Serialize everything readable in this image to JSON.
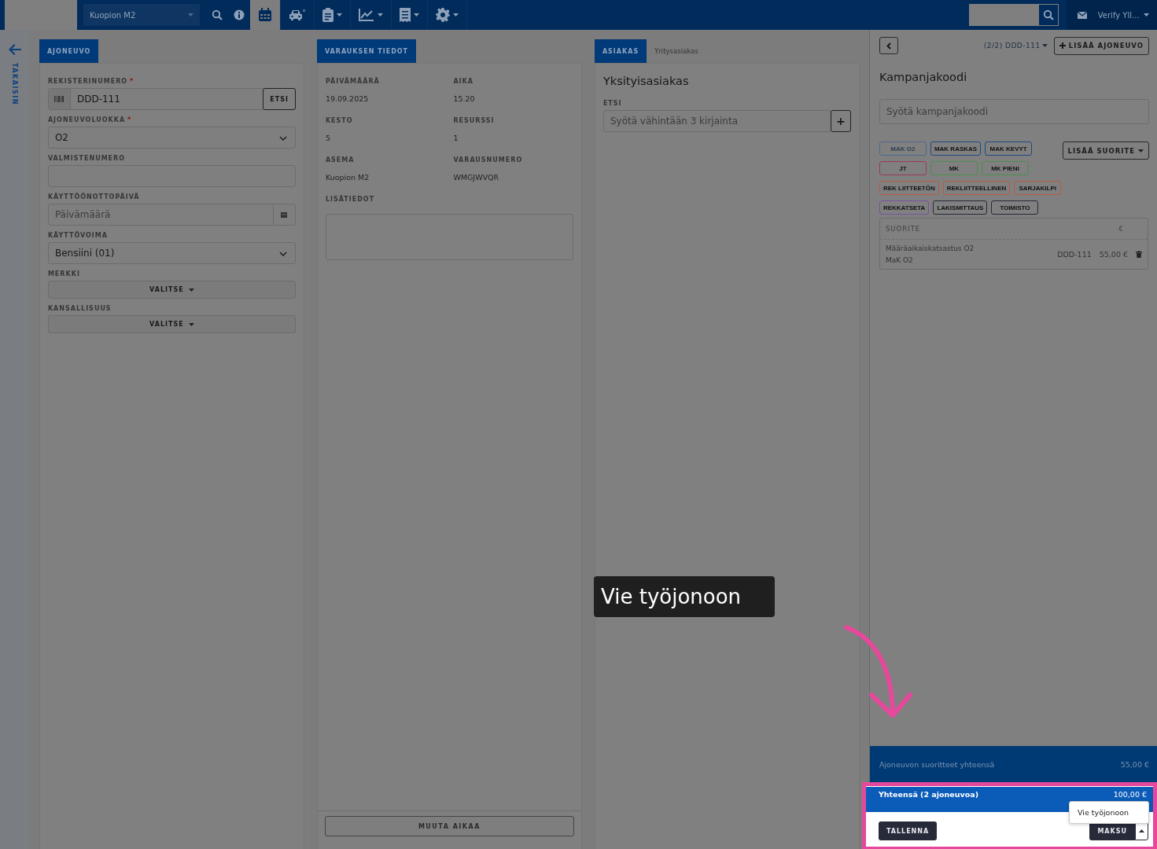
{
  "topbar": {
    "station_select": {
      "value": "Kuopion M2"
    },
    "nav_items": [
      {
        "kind": "search",
        "selected": false,
        "has_menu": false
      },
      {
        "kind": "info",
        "selected": false,
        "has_menu": false
      },
      {
        "kind": "calendar",
        "selected": true,
        "has_menu": false
      },
      {
        "kind": "car",
        "selected": false,
        "has_menu": false
      },
      {
        "kind": "clipboard",
        "selected": false,
        "has_menu": true
      },
      {
        "kind": "chart",
        "selected": false,
        "has_menu": true
      },
      {
        "kind": "receipt",
        "selected": false,
        "has_menu": true
      },
      {
        "kind": "gear",
        "selected": false,
        "has_menu": true
      }
    ],
    "user": {
      "name": "Verify Yll…"
    }
  },
  "sidebar": {
    "back_label": "TAKAISIN"
  },
  "vehicle_panel": {
    "tab": "AJONEUVO",
    "fields": [
      {
        "kind": "lookup",
        "label": "REKISTERINUMERO",
        "required_mark": "*",
        "value": "DDD-111",
        "button": "ETSI"
      },
      {
        "kind": "select",
        "label": "AJONEUVOLUOKKA",
        "required_mark": "*",
        "value": "O2"
      },
      {
        "kind": "text",
        "label": "VALMISTENUMERO"
      },
      {
        "kind": "date",
        "label": "KÄYTTÖÖNOTTOPÄIVÄ",
        "placeholder": "Päivämäärä"
      },
      {
        "kind": "select",
        "label": "KÄYTTÖVOIMA",
        "value": "Bensiini (01)"
      },
      {
        "kind": "dropdown",
        "label": "MERKKI",
        "button": "VALITSE"
      },
      {
        "kind": "dropdown",
        "label": "KANSALLISUUS",
        "button": "VALITSE"
      }
    ]
  },
  "booking_panel": {
    "tab": "VARAUKSEN TIEDOT",
    "details": [
      {
        "label": "PÄIVÄMÄÄRÄ",
        "value": "19.09.2025"
      },
      {
        "label": "AIKA",
        "value": "15.20"
      },
      {
        "label": "KESTO",
        "value": "5"
      },
      {
        "label": "RESURSSI",
        "value": "1"
      },
      {
        "label": "ASEMA",
        "value": "Kuopion M2"
      },
      {
        "label": "VARAUSNUMERO",
        "value": "WMGJWVQR"
      }
    ],
    "notes_label": "LISÄTIEDOT",
    "change_time_button": "MUUTA AIKAA"
  },
  "customer_panel": {
    "tabs": [
      {
        "label": "ASIAKAS",
        "selected": true
      },
      {
        "label": "Yritysasiakas",
        "selected": false
      }
    ],
    "heading": "Yksityisasiakas",
    "search_label": "ETSI",
    "search_placeholder": "Syötä vähintään 3 kirjainta",
    "add_button": "+"
  },
  "right_panel": {
    "vehicle_switch": "(2/2) DDD-111",
    "add_vehicle_button": "LISÄÄ AJONEUVO",
    "campaign_heading": "Kampanjakoodi",
    "campaign_placeholder": "Syötä kampanjakoodi",
    "chip_rows": [
      [
        {
          "label": "MAK O2",
          "color": "#4d6a8c",
          "disabled": true
        },
        {
          "label": "MAK RASKAS",
          "color": "#1c4a85",
          "disabled": false
        },
        {
          "label": "MAK KEVYT",
          "color": "#1c4a85",
          "disabled": false
        }
      ],
      [
        {
          "label": "JT",
          "color": "#98385a",
          "disabled": false
        },
        {
          "label": "MK",
          "color": "#4b8f4b",
          "disabled": false
        },
        {
          "label": "MK PIENI",
          "color": "#4b8f4b",
          "disabled": false
        }
      ],
      [
        {
          "label": "REK LIITTEETÖN",
          "color": "#b85a40",
          "disabled": false
        },
        {
          "label": "REKLIITTEELLINEN",
          "color": "#b85a40",
          "disabled": false
        },
        {
          "label": "SARJAKILPI",
          "color": "#b85a40",
          "disabled": false
        }
      ],
      [
        {
          "label": "REKKATSETA",
          "color": "#7b4f9c",
          "disabled": false
        },
        {
          "label": "LAKISMITTAUS",
          "color": "#262a36",
          "disabled": false
        },
        {
          "label": "TOIMISTO",
          "color": "#262a36",
          "disabled": false
        }
      ]
    ],
    "add_service_button": "LISÄÄ SUORITE",
    "table": {
      "columns": [
        "SUORITE",
        "€"
      ],
      "rows": [
        {
          "name": "Määräaikaiskatsastus O2",
          "detail": "MaK O2",
          "plate": "DDD-111",
          "price": "55,00 €"
        }
      ]
    },
    "vehicle_total": {
      "label": "Ajoneuvon suoritteet yhteensä",
      "value": "55,00 €"
    },
    "grand_total": {
      "label": "Yhteensä (2 ajoneuvoa)",
      "value": "100,00 €"
    },
    "save_button": "TALLENNA",
    "pay_button": "MAKSU",
    "pay_menu": [
      "Vie työjonoon"
    ]
  },
  "tutorial": {
    "tooltip": "Vie työjonoon"
  }
}
